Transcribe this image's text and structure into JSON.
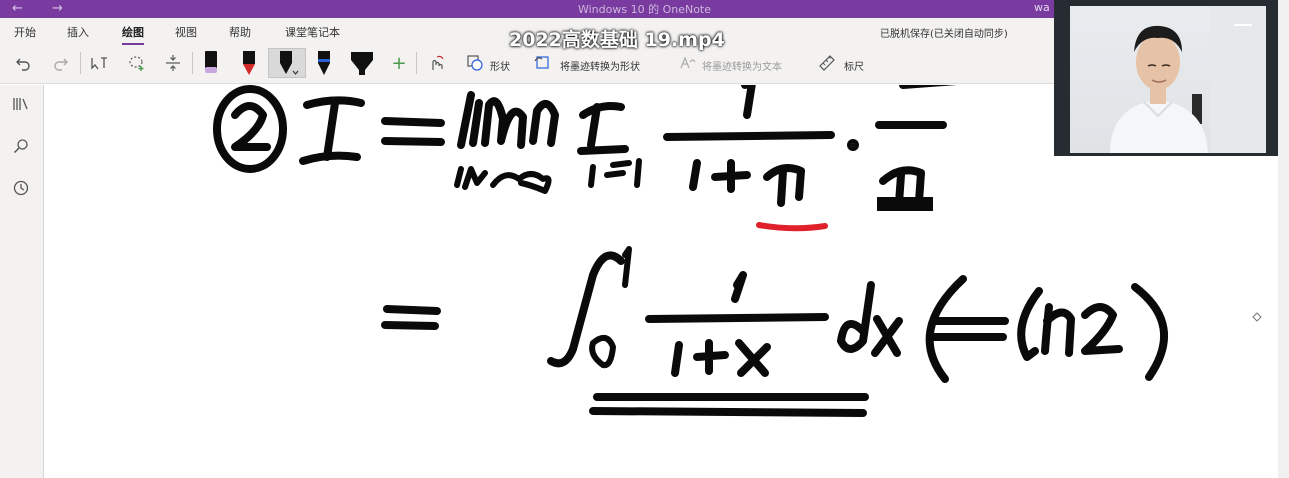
{
  "window": {
    "title": "Windows 10 的 OneNote",
    "user_fragment": "wa",
    "back_glyph": "←",
    "forward_glyph": "→"
  },
  "ribbon": {
    "tabs": [
      {
        "label": "开始"
      },
      {
        "label": "插入"
      },
      {
        "label": "绘图",
        "active": true
      },
      {
        "label": "视图"
      },
      {
        "label": "帮助"
      },
      {
        "label": "课堂笔记本"
      }
    ],
    "save_status": "已脱机保存(已关闭自动同步)",
    "tools": {
      "undo_icon": "undo-icon",
      "redo_icon": "redo-icon",
      "shapes_label": "形状",
      "ink_to_shape_label": "将墨迹转换为形状",
      "ink_to_text_label": "将墨迹转换为文本",
      "ruler_label": "标尺"
    },
    "pens": [
      {
        "name": "pen-black-purple",
        "body": "#111111",
        "tip": "#c9a8e0"
      },
      {
        "name": "pen-red",
        "body": "#111111",
        "tip": "#d42a2a"
      },
      {
        "name": "pen-black-selected",
        "body": "#111111",
        "tip": "#111111"
      },
      {
        "name": "pen-blue",
        "body": "#111111",
        "tip": "#2b5fd9"
      },
      {
        "name": "highlighter-black",
        "body": "#111111",
        "tip": "#111111"
      }
    ]
  },
  "video": {
    "title": "2022高数基础 19.mp4"
  },
  "sidebar": {
    "icons": [
      "notebooks-icon",
      "search-icon",
      "recent-clock-icon"
    ]
  },
  "colors": {
    "accent": "#7a3ba0",
    "ink_black": "#0a0a0a",
    "ink_red": "#e0202a",
    "webcam_bg": "#262c32"
  }
}
